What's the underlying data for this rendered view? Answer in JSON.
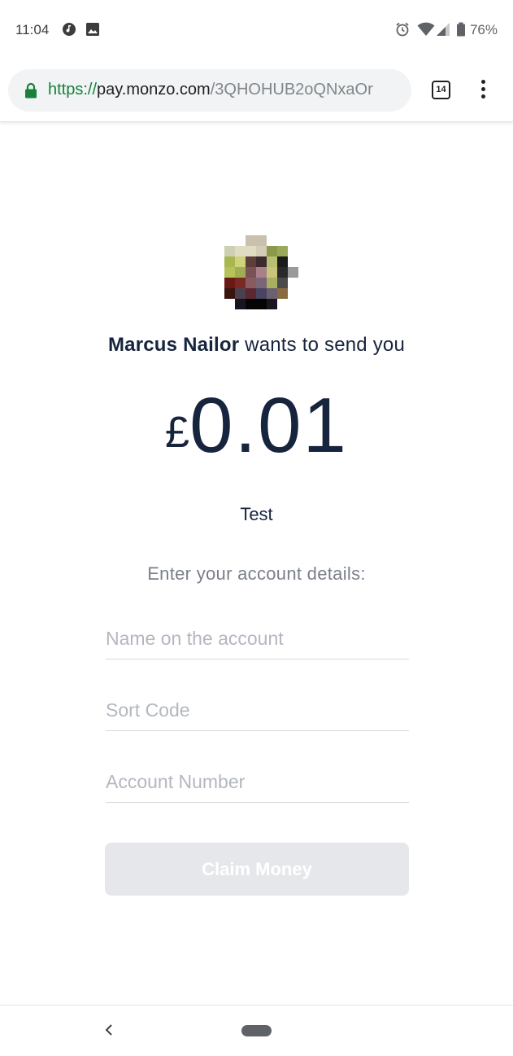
{
  "status_bar": {
    "time": "11:04",
    "icons": [
      "music-note-icon",
      "image-icon",
      "alarm-icon",
      "wifi-icon",
      "signal-icon",
      "battery-icon"
    ],
    "battery_percent": "76%"
  },
  "browser": {
    "url_scheme": "https://",
    "url_host": "pay.monzo.com",
    "url_path": "/3QHOHUB2oQNxaOr",
    "tab_count": "14",
    "colors": {
      "secure_green": "#188038"
    }
  },
  "payment": {
    "sender_name": "Marcus Nailor",
    "sender_action": " wants to send you",
    "currency_symbol": "£",
    "amount": "0.01",
    "note": "Test",
    "details_prompt": "Enter your account details:"
  },
  "form": {
    "name_placeholder": "Name on the account",
    "sort_code_placeholder": "Sort Code",
    "account_number_placeholder": "Account Number",
    "claim_label": "Claim Money"
  },
  "colors": {
    "text_primary": "#17243d",
    "text_muted": "#7a7f8a",
    "button_disabled": "#e6e7ea"
  }
}
